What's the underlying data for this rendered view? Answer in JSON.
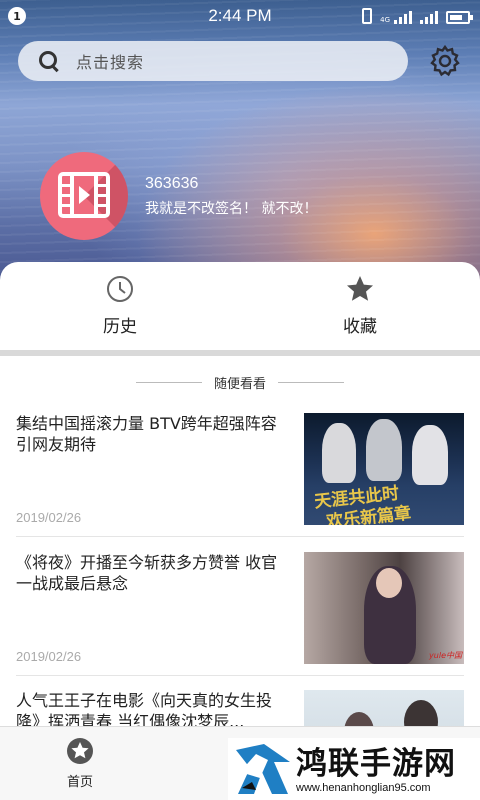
{
  "status_bar": {
    "notification_count": "1",
    "time": "2:44 PM",
    "network": "4G"
  },
  "search": {
    "placeholder": "点击搜索"
  },
  "profile": {
    "username": "363636",
    "signature": "我就是不改签名！ 就不改！"
  },
  "quick_actions": {
    "history_label": "历史",
    "favorites_label": "收藏"
  },
  "feed": {
    "section_title": "随便看看",
    "articles": [
      {
        "title": "集结中国摇滚力量 BTV跨年超强阵容引网友期待",
        "date": "2019/02/26",
        "thumb_text_1": "天涯共此时",
        "thumb_text_2": "欢乐新篇章"
      },
      {
        "title": "《将夜》开播至今斩获多方赞誉 收官一战成最后悬念",
        "date": "2019/02/26",
        "thumb_mark": "yule中国"
      },
      {
        "title": "人气王王子在电影《向天真的女生投降》挥洒青春 当红偶像沈梦辰...",
        "date": ""
      }
    ]
  },
  "bottom_nav": {
    "home_label": "首页"
  },
  "watermark": {
    "title": "鸿联手游网",
    "url": "www.henanhonglian95.com"
  },
  "colors": {
    "avatar": "#ef6a7c",
    "accent_text": "#222222",
    "muted_text": "#aaaaaa"
  },
  "icons": {
    "search": "search-icon",
    "settings": "gear-icon",
    "history": "clock-icon",
    "favorites": "star-icon",
    "home": "home-star-icon",
    "avatar": "video-film-icon"
  }
}
